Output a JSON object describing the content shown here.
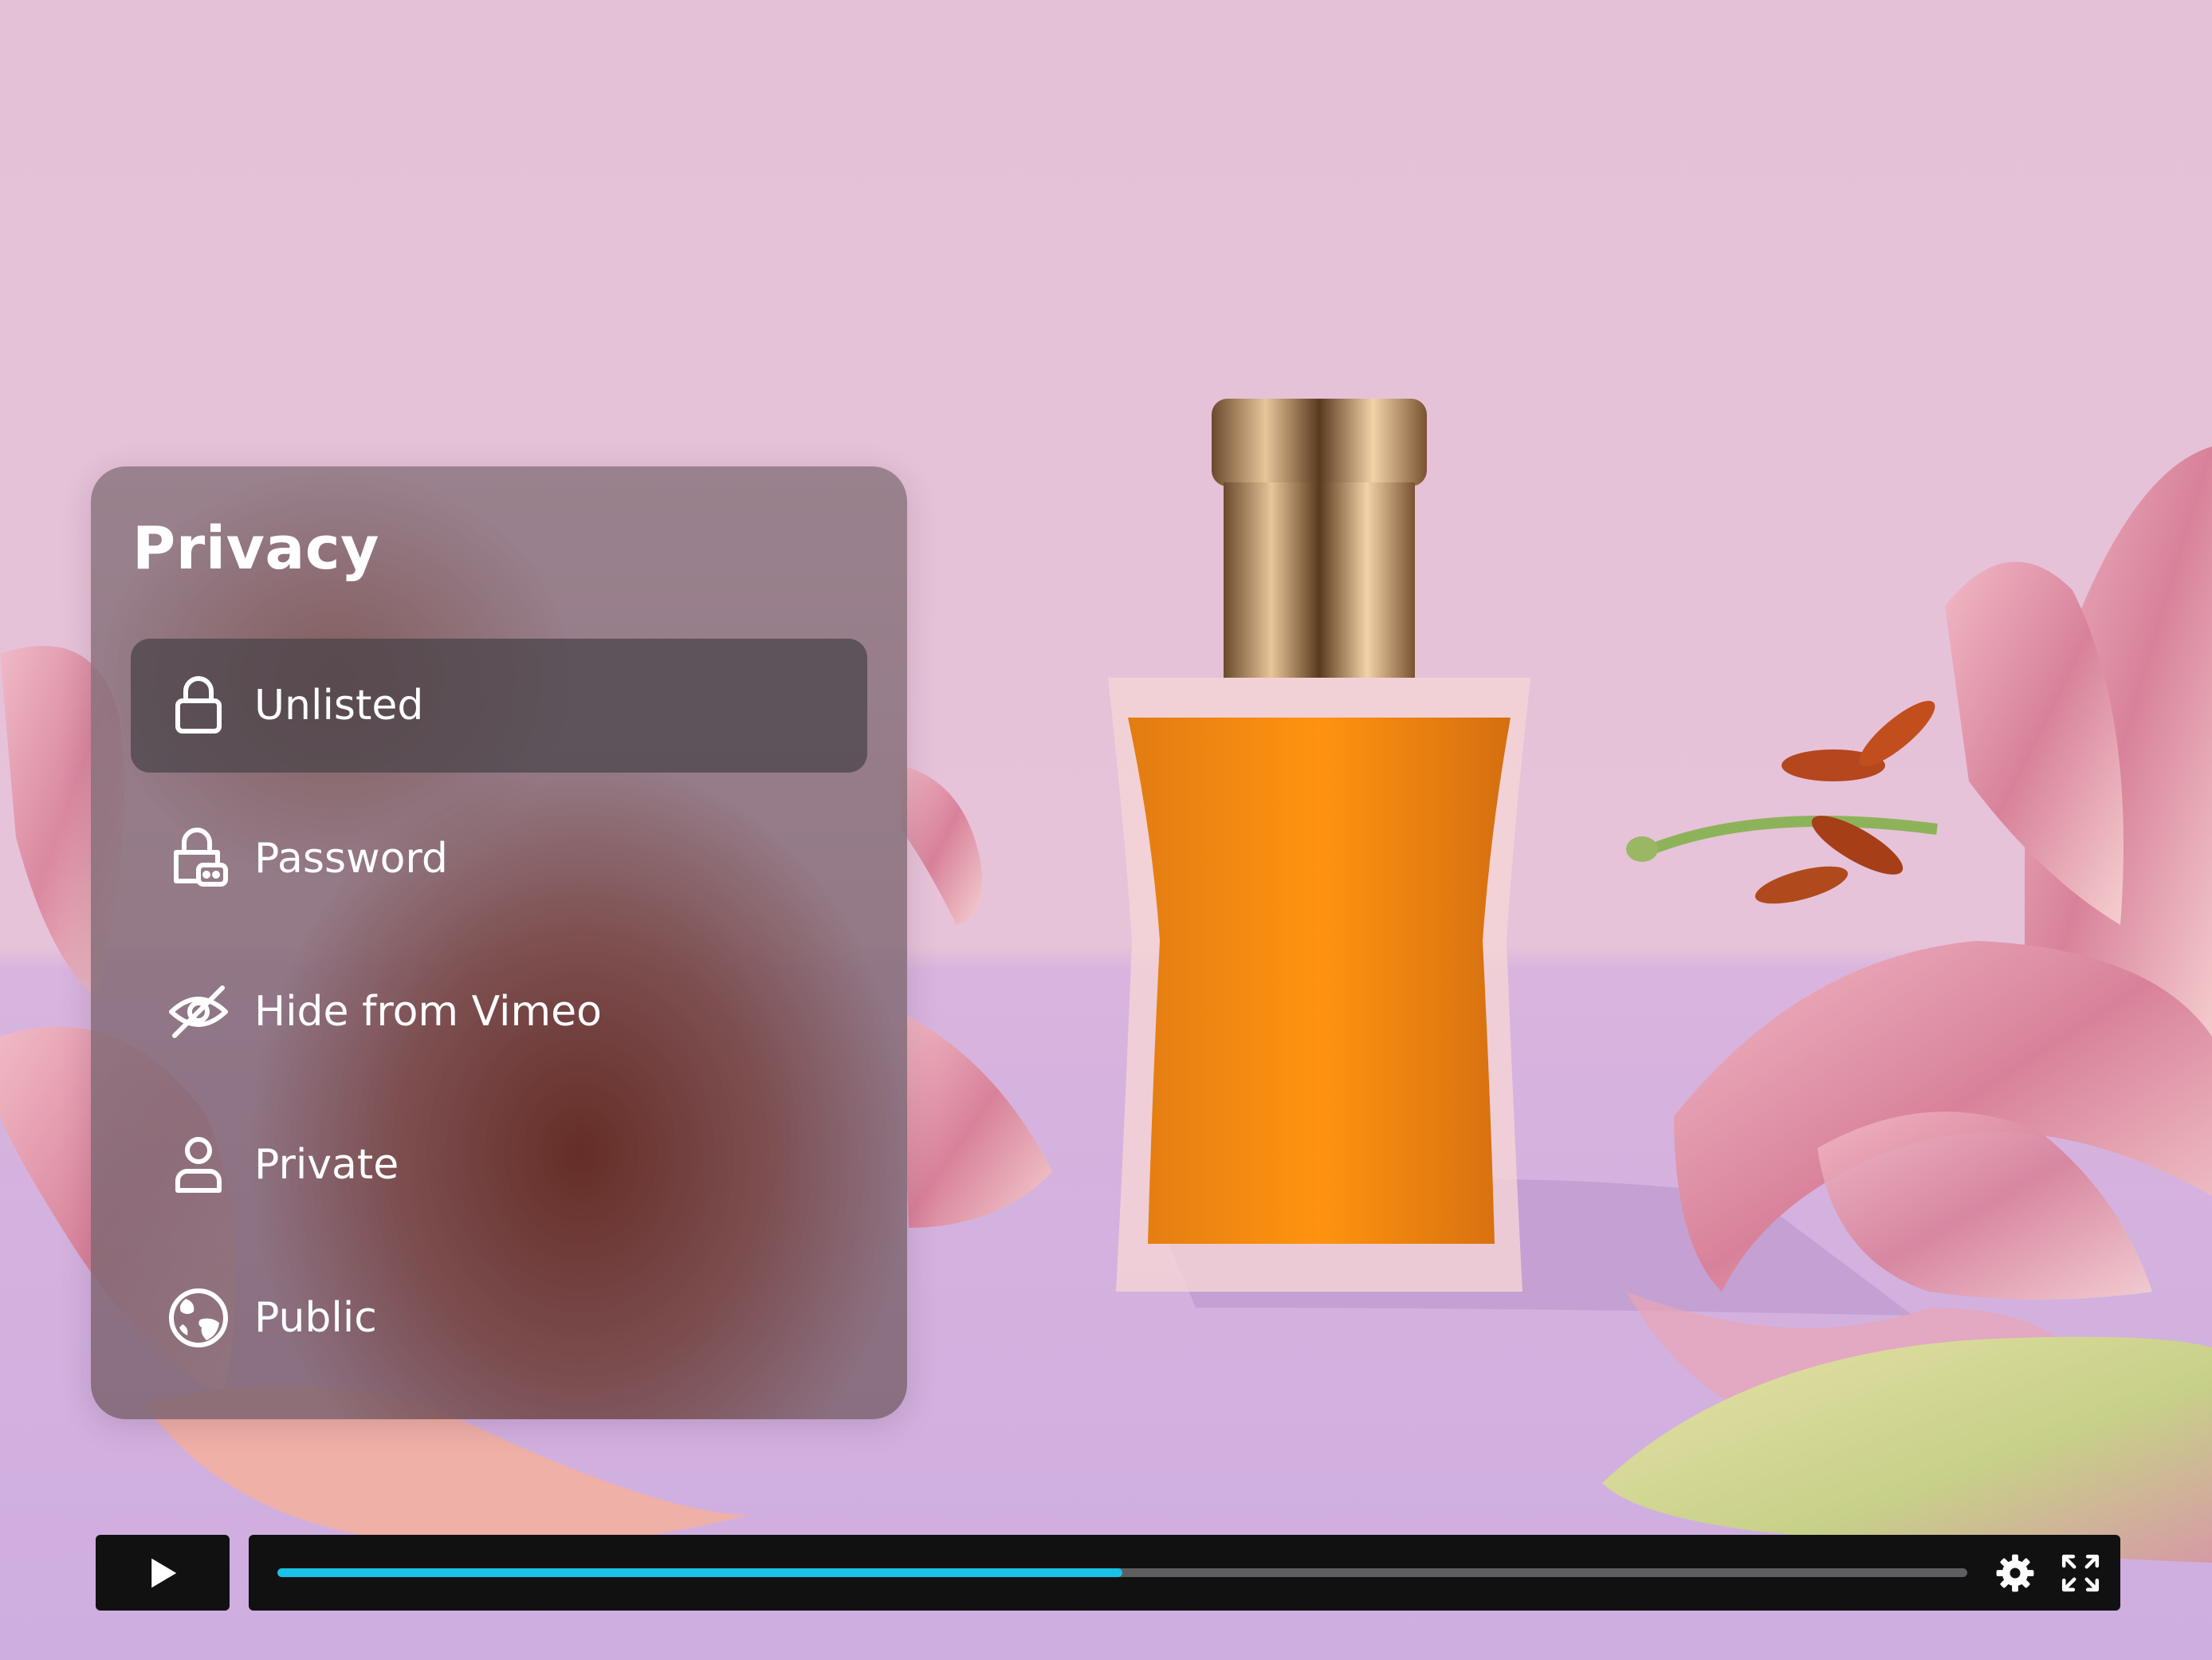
{
  "panel": {
    "title": "Privacy",
    "items": [
      {
        "label": "Unlisted",
        "icon": "lock-icon",
        "selected": true
      },
      {
        "label": "Password",
        "icon": "lock-password-icon",
        "selected": false
      },
      {
        "label": "Hide from Vimeo",
        "icon": "eye-slash-icon",
        "selected": false
      },
      {
        "label": "Private",
        "icon": "user-icon",
        "selected": false
      },
      {
        "label": "Public",
        "icon": "globe-icon",
        "selected": false
      }
    ]
  },
  "player": {
    "progress_fraction": 0.5,
    "icons": [
      "play-icon",
      "gear-icon",
      "fullscreen-icon"
    ]
  },
  "colors": {
    "accent": "#19c2e6",
    "controls_bg": "#111112",
    "background_wall": "#e6c3d9",
    "background_table": "#ceaee0"
  }
}
